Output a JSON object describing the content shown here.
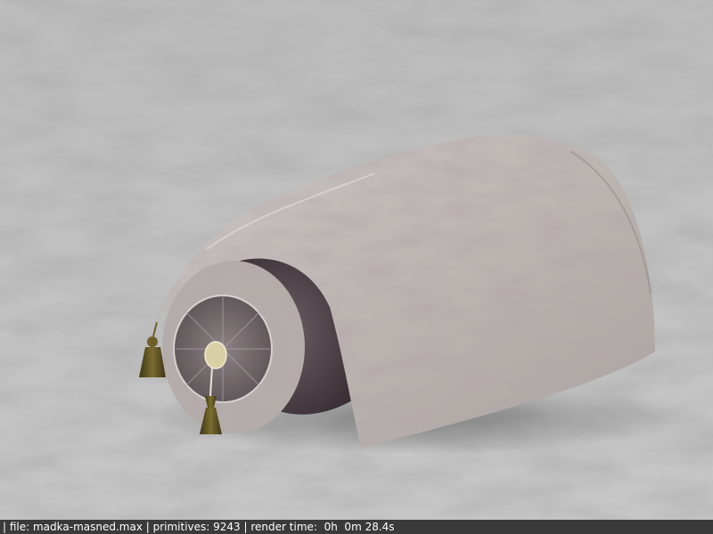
{
  "scene": {
    "subject_icon": "tasseled-bolster-cushion-icon",
    "floor_color": "#c4c4c4",
    "cushion_color": "#bdb6b2",
    "bolster_color": "#4d4248",
    "tassel_color": "#5a4f24"
  },
  "status_bar": {
    "file_segment": "| file: madka-masned.max",
    "primitives_segment": " | primitives: 9243",
    "render_time_segment": " | render time:  0h  0m 28.4s"
  }
}
